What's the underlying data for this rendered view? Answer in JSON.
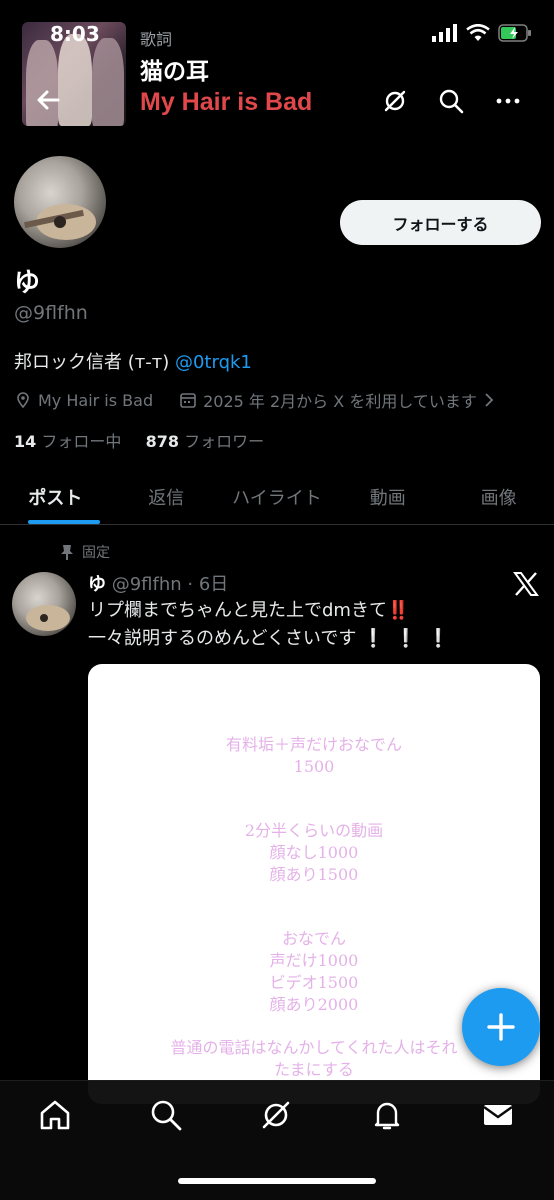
{
  "status": {
    "time": "8:03"
  },
  "now_playing": {
    "label": "歌詞",
    "title": "猫の耳",
    "artist": "My Hair is Bad"
  },
  "profile": {
    "follow_label": "フォローする",
    "display_name": "ゆ",
    "handle": "@9flfhn",
    "bio_text": "邦ロック信者 (ᴛ-ᴛ) ",
    "bio_mention": "@0trqk1",
    "location": "My Hair is Bad",
    "joined": "2025 年 2月から X を利用しています",
    "following_count": "14",
    "following_label": "フォロー中",
    "followers_count": "878",
    "followers_label": "フォロワー"
  },
  "tabs": [
    {
      "label": "ポスト",
      "active": true
    },
    {
      "label": "返信"
    },
    {
      "label": "ハイライト"
    },
    {
      "label": "動画"
    },
    {
      "label": "画像"
    }
  ],
  "post": {
    "pinned_label": "固定",
    "author": "ゆ",
    "handle_time": "@9flfhn · 6日",
    "line1": "リプ欄までちゃんと見た上でdmきて",
    "line1_emoji": "‼️",
    "line2": "一々説明するのめんどくさいです",
    "line2_emoji": "❕❕❕",
    "image_lines": {
      "block1": [
        "有料垢＋声だけおなでん",
        "1500"
      ],
      "block2": [
        "2分半くらいの動画",
        "顔なし1000",
        "顔あり1500"
      ],
      "block3": [
        "おなでん",
        "声だけ1000",
        "ビデオ1500",
        "顔あり2000"
      ],
      "block4": [
        "普通の電話はなんかしてくれた人はそれ",
        "たまにする"
      ]
    }
  },
  "icons": [
    "back-arrow-icon",
    "no-sync-icon",
    "search-icon",
    "more-icon",
    "location-icon",
    "calendar-icon",
    "pin-icon",
    "x-logo-icon",
    "plus-icon",
    "home-icon",
    "grok-icon",
    "bell-icon",
    "mail-icon"
  ],
  "colors": {
    "accent": "#1d9bf0",
    "artist": "#e0484b",
    "image_text": "#e4b2e8"
  }
}
